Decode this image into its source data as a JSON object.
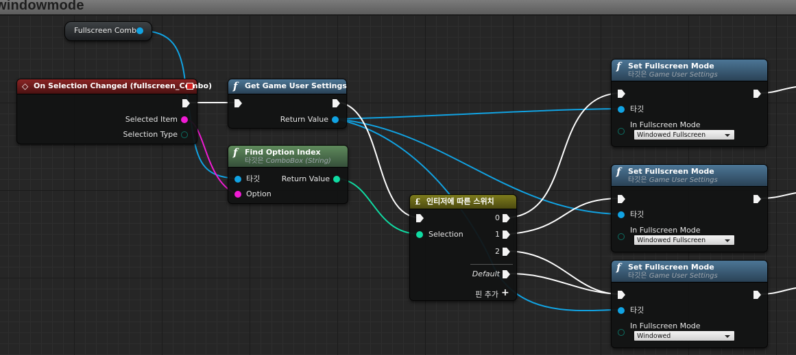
{
  "window": {
    "title": "windowmode"
  },
  "variable": {
    "label": "Fullscreen Combo"
  },
  "event_node": {
    "title": "On Selection Changed (fullscreen_Combo)",
    "pin_selected_item": "Selected Item",
    "pin_selection_type": "Selection Type"
  },
  "get_settings": {
    "title": "Get Game User Settings",
    "pin_return": "Return Value"
  },
  "find_option": {
    "title": "Find Option Index",
    "subtitle_prefix": "타깃은",
    "subtitle_class": "ComboBox (String)",
    "pin_target": "타깃",
    "pin_option": "Option",
    "pin_return": "Return Value"
  },
  "switch_node": {
    "title": "인티저에 따른 스위치",
    "pin_selection": "Selection",
    "outputs": [
      "0",
      "1",
      "2",
      "Default"
    ],
    "add_pin": "핀 추가"
  },
  "set_nodes": [
    {
      "title": "Set Fullscreen Mode",
      "subtitle_prefix": "타깃은",
      "subtitle_class": "Game User Settings",
      "pin_target": "타깃",
      "pin_mode": "In Fullscreen Mode",
      "mode_value": "Windowed Fullscreen"
    },
    {
      "title": "Set Fullscreen Mode",
      "subtitle_prefix": "타깃은",
      "subtitle_class": "Game User Settings",
      "pin_target": "타깃",
      "pin_mode": "In Fullscreen Mode",
      "mode_value": "Windowed Fullscreen"
    },
    {
      "title": "Set Fullscreen Mode",
      "subtitle_prefix": "타깃은",
      "subtitle_class": "Game User Settings",
      "pin_target": "타깃",
      "pin_mode": "In Fullscreen Mode",
      "mode_value": "Windowed"
    }
  ],
  "colors": {
    "exec_wire": "#ffffff",
    "object_wire": "#11a3e3",
    "string_wire": "#f01bd4",
    "int_wire": "#10dca3"
  }
}
